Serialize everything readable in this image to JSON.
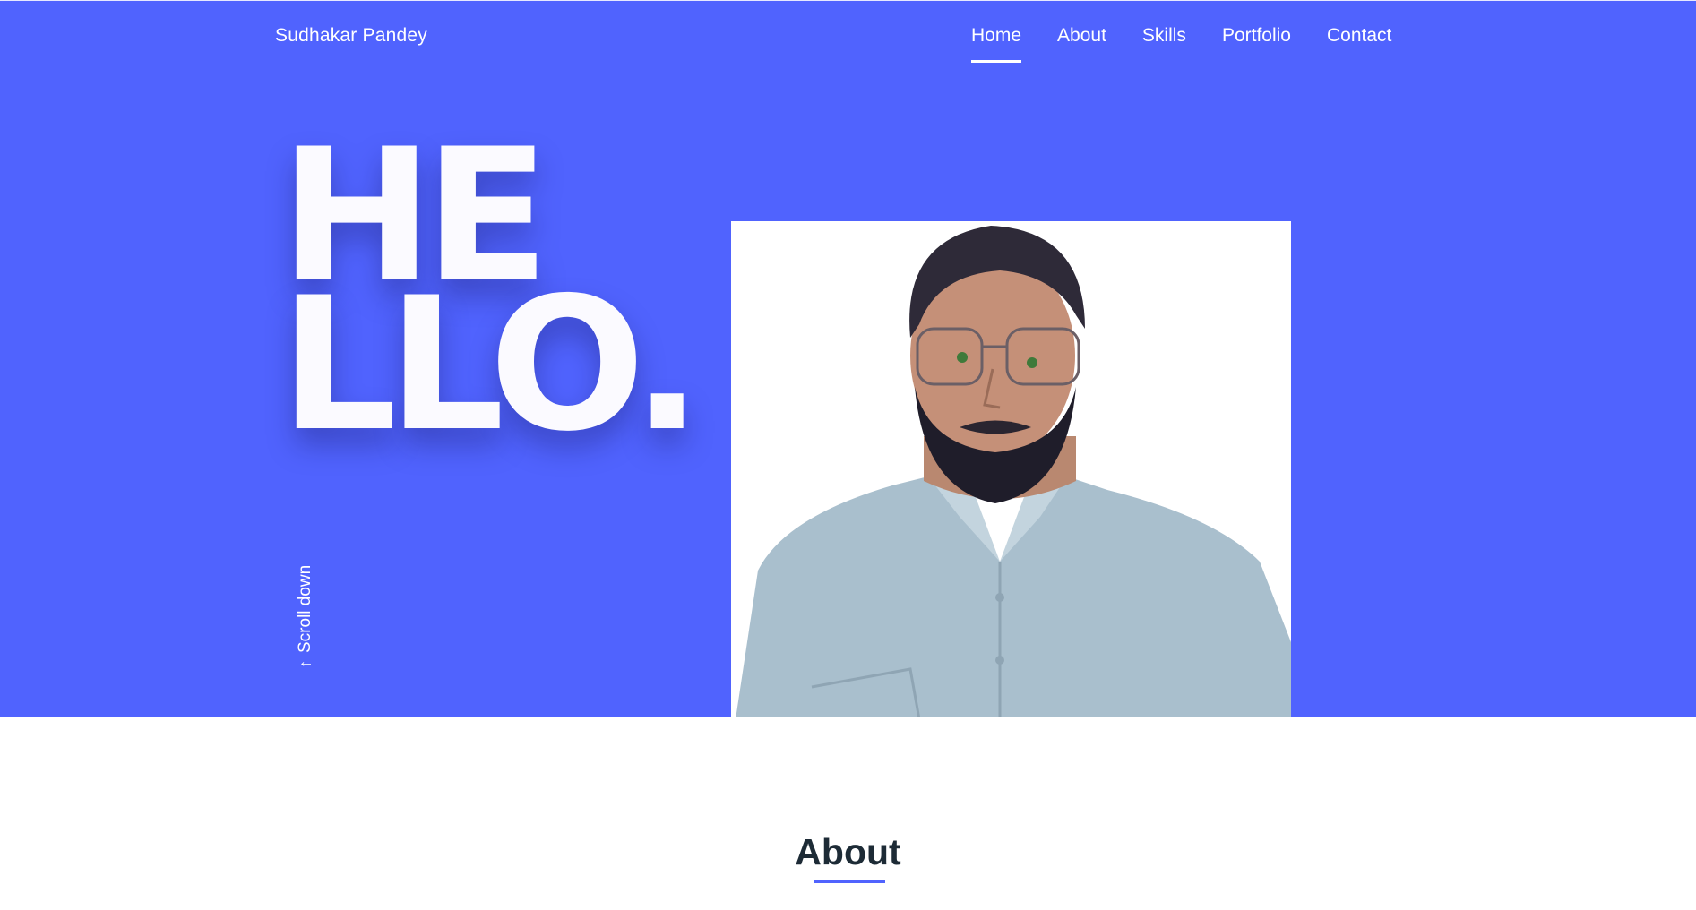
{
  "header": {
    "brand": "Sudhakar Pandey",
    "nav": [
      {
        "label": "Home",
        "active": true
      },
      {
        "label": "About",
        "active": false
      },
      {
        "label": "Skills",
        "active": false
      },
      {
        "label": "Portfolio",
        "active": false
      },
      {
        "label": "Contact",
        "active": false
      }
    ]
  },
  "hero": {
    "hello_line1": "HE",
    "hello_line2": "LLO.",
    "scroll_label": "Scroll down",
    "scroll_arrow": "→"
  },
  "about": {
    "title": "About"
  },
  "colors": {
    "primary": "#5063fe",
    "heading": "#1d2b36",
    "text_light": "#ffffff"
  },
  "icons": {
    "scroll": "arrow-down-icon"
  }
}
